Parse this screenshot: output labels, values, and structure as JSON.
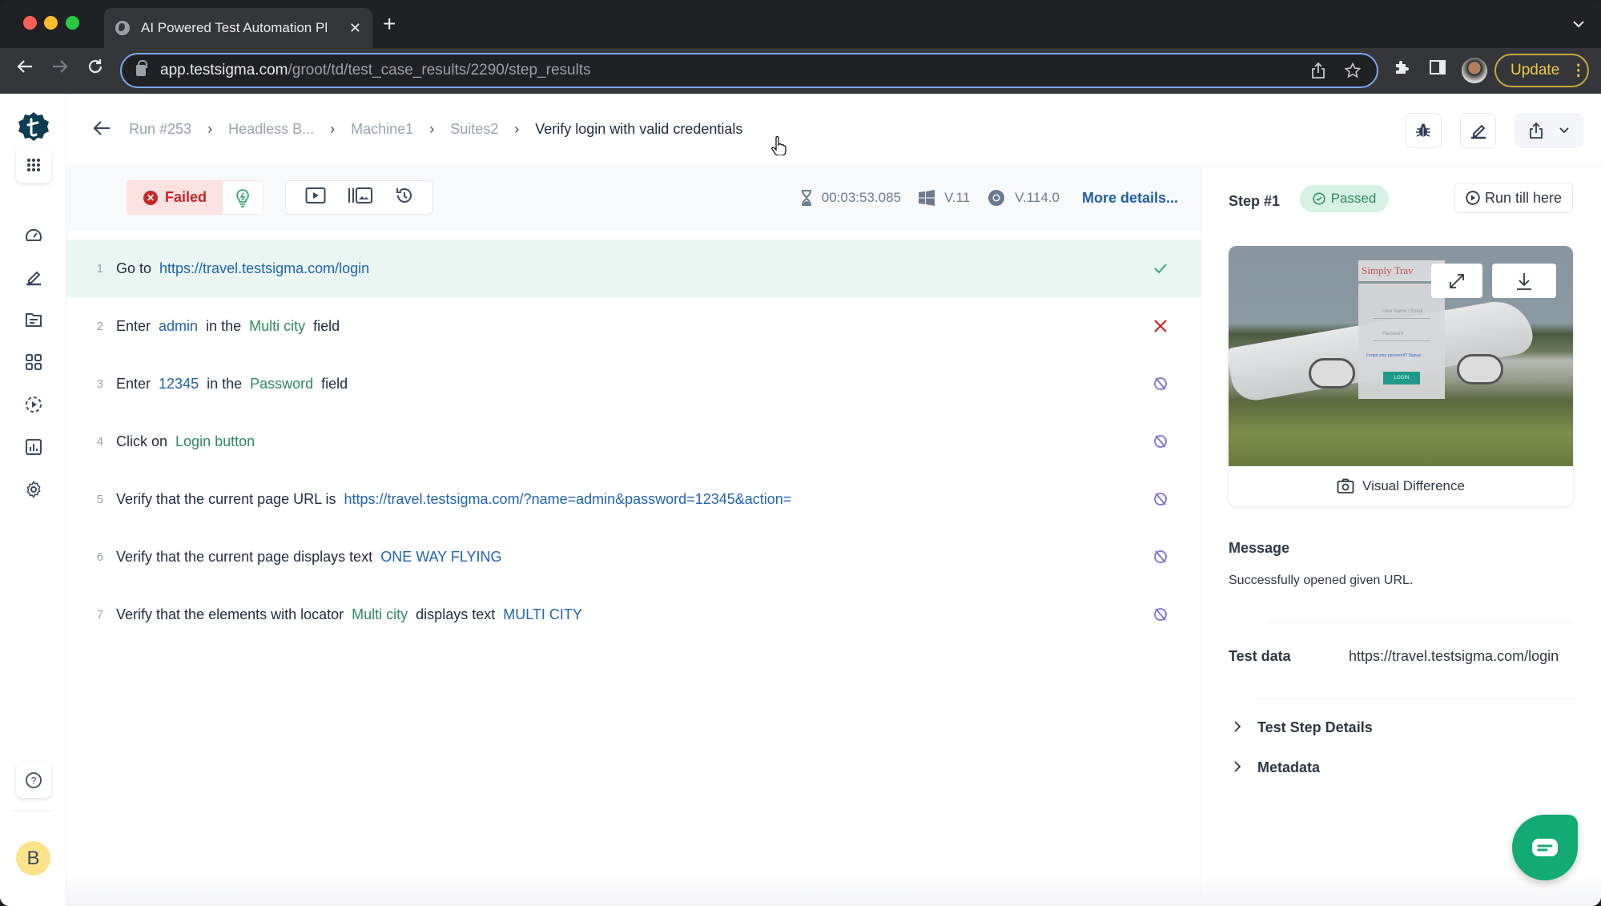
{
  "browser": {
    "tab_title": "AI Powered Test Automation Pl",
    "url_host": "app.testsigma.com",
    "url_path": "/groot/td/test_case_results/2290/step_results",
    "update_label": "Update"
  },
  "sidebar": {
    "items": [
      {
        "name": "apps-grid",
        "active": true
      },
      {
        "name": "dashboard"
      },
      {
        "name": "create-tests"
      },
      {
        "name": "test-data"
      },
      {
        "name": "modules"
      },
      {
        "name": "runs"
      },
      {
        "name": "reports"
      },
      {
        "name": "settings"
      }
    ],
    "help_label": "?",
    "avatar_initial": "B"
  },
  "header": {
    "breadcrumbs": [
      "Run #253",
      "Headless B...",
      "Machine1",
      "Suites2"
    ],
    "current": "Verify login with valid credentials"
  },
  "toolbar": {
    "status_label": "Failed",
    "duration": "00:03:53.085",
    "os_version": "V.11",
    "browser_version": "V.114.0",
    "more_details_label": "More details..."
  },
  "steps": [
    {
      "num": "1",
      "status": "passed",
      "tokens": [
        {
          "t": "Go to",
          "k": "kw"
        },
        {
          "t": "https://travel.testsigma.com/login",
          "k": "val"
        }
      ]
    },
    {
      "num": "2",
      "status": "failed",
      "tokens": [
        {
          "t": "Enter",
          "k": "kw"
        },
        {
          "t": "admin",
          "k": "val"
        },
        {
          "t": "in the",
          "k": "kw"
        },
        {
          "t": "Multi city",
          "k": "el"
        },
        {
          "t": "field",
          "k": "kw"
        }
      ]
    },
    {
      "num": "3",
      "status": "not-executed",
      "tokens": [
        {
          "t": "Enter",
          "k": "kw"
        },
        {
          "t": "12345",
          "k": "val"
        },
        {
          "t": "in the",
          "k": "kw"
        },
        {
          "t": "Password",
          "k": "el"
        },
        {
          "t": "field",
          "k": "kw"
        }
      ]
    },
    {
      "num": "4",
      "status": "not-executed",
      "tokens": [
        {
          "t": "Click on",
          "k": "kw"
        },
        {
          "t": "Login button",
          "k": "el"
        }
      ]
    },
    {
      "num": "5",
      "status": "not-executed",
      "tokens": [
        {
          "t": "Verify that the current page URL is",
          "k": "kw"
        },
        {
          "t": "https://travel.testsigma.com/?name=admin&password=12345&action=",
          "k": "val"
        }
      ]
    },
    {
      "num": "6",
      "status": "not-executed",
      "tokens": [
        {
          "t": "Verify that the current page displays text",
          "k": "kw"
        },
        {
          "t": "ONE WAY FLYING",
          "k": "val"
        }
      ]
    },
    {
      "num": "7",
      "status": "not-executed",
      "tokens": [
        {
          "t": "Verify that the elements with locator",
          "k": "kw"
        },
        {
          "t": "Multi city",
          "k": "el"
        },
        {
          "t": "displays text",
          "k": "kw"
        },
        {
          "t": "MULTI CITY",
          "k": "val"
        }
      ]
    }
  ],
  "panel": {
    "step_label": "Step #1",
    "status_label": "Passed",
    "run_till_label": "Run till here",
    "screenshot": {
      "logo_text": "Simply Trav",
      "username_placeholder": "User Name / Email",
      "password_placeholder": "Password",
      "forgot_text": "Forgot your password?  Signup",
      "login_text": "LOGIN"
    },
    "visual_diff_label": "Visual Difference",
    "message_label": "Message",
    "message_text": "Successfully opened given URL.",
    "test_data_label": "Test data",
    "test_data_value": "https://travel.testsigma.com/login",
    "expanders": [
      "Test Step Details",
      "Metadata"
    ]
  },
  "colors": {
    "passed": "#2fae73",
    "failed": "#c42828",
    "not_executed": "#7a72d8",
    "link": "#1f63b0",
    "element": "#2d8a5e",
    "brand": "#0d3d52",
    "chat": "#12ab73"
  }
}
